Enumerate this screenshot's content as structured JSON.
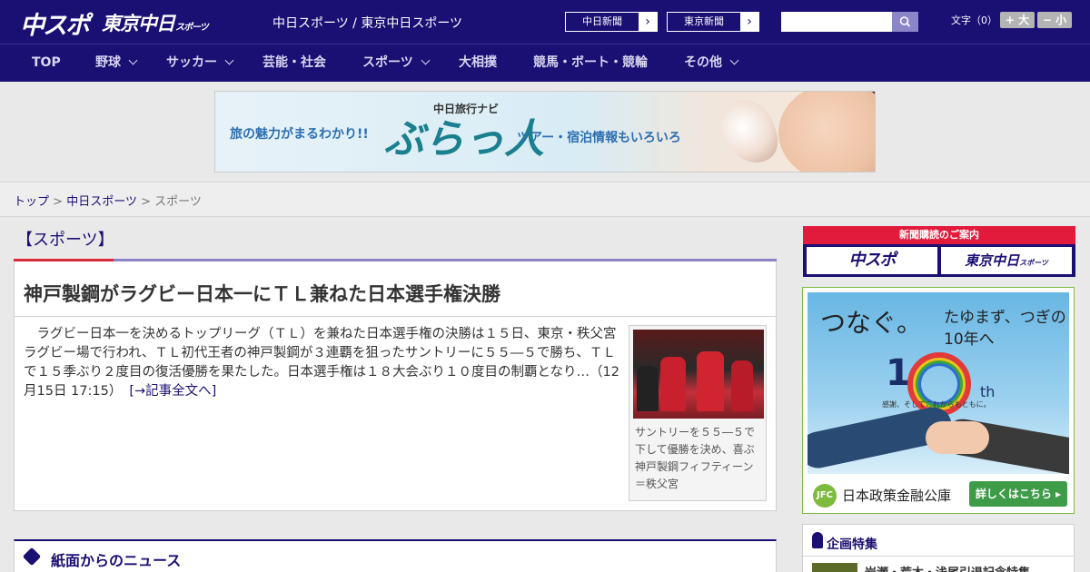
{
  "header": {
    "logo_chuspo": "中スポ",
    "logo_tokyo": "東京中日",
    "logo_tokyo_sub": "スポーツ",
    "site_title": "中日スポーツ / 東京中日スポーツ",
    "paper_links": [
      {
        "label": "中日新聞",
        "arrow": "›"
      },
      {
        "label": "東京新聞",
        "arrow": "›"
      }
    ],
    "search": {
      "placeholder": "",
      "value": ""
    },
    "text_size_label": "文字（0）",
    "text_size_up": "+ 大",
    "text_size_down": "− 小"
  },
  "nav": {
    "items": [
      {
        "label": "TOP"
      },
      {
        "label": "野球"
      },
      {
        "label": "サッカー"
      },
      {
        "label": "芸能・社会"
      },
      {
        "label": "スポーツ"
      },
      {
        "label": "大相撲"
      },
      {
        "label": "競馬・ボート・競輪"
      },
      {
        "label": "その他"
      }
    ]
  },
  "banner": {
    "tagline_left": "旅の魅力がまるわかり!!",
    "brand_small": "中日旅行ナビ",
    "brand_big": "ぶらっ人",
    "tagline_right": "ツアー・宿泊情報もいろいろ"
  },
  "breadcrumb": {
    "items": [
      "トップ",
      "中日スポーツ",
      "スポーツ"
    ],
    "separator": ">"
  },
  "main": {
    "category_title": "【スポーツ】",
    "article": {
      "headline": "神戸製鋼がラグビー日本一にＴＬ兼ねた日本選手権決勝",
      "body": "　ラグビー日本一を決めるトップリーグ（ＴＬ）を兼ねた日本選手権の決勝は１５日、東京・秩父宮ラグビー場で行われ、ＴＬ初代王者の神戸製鋼が３連覇を狙ったサントリーに５５―５で勝ち、ＴＬで１５季ぶり２度目の復活優勝を果たした。日本選手権は１８大会ぶり１０度目の制覇となり…（12月15日 17:15）",
      "more_link": "[→記事全文へ]",
      "photo_caption": "サントリーを５５―５で下して優勝を決め、喜ぶ神戸製鋼フィフティーン＝秩父宮"
    },
    "news_section_title": "紙面からのニュース"
  },
  "sidebar": {
    "subscribe": {
      "header": "新聞購読のご案内",
      "logo_chuspo": "中スポ",
      "logo_tokyo": "東京中日",
      "logo_tokyo_sub": "スポーツ"
    },
    "ad": {
      "headline": "つなぐ。",
      "subline": "たゆまず、つぎの10年へ",
      "number": "1",
      "suffix": "th",
      "thanks": "感謝、そしてこれからもともに。",
      "org_logo": "JFC",
      "org_name": "日本政策金融公庫",
      "cta": "詳しくはこちら ▸"
    },
    "kikaku": {
      "title": "企画特集",
      "item": "岩瀬・荒木・浅尾引退記念特集"
    }
  },
  "colors": {
    "header_bg": "#1a0f73",
    "accent_red": "#d62a3b",
    "accent_purple": "#8b83c6",
    "ad_green": "#3e9b48"
  }
}
